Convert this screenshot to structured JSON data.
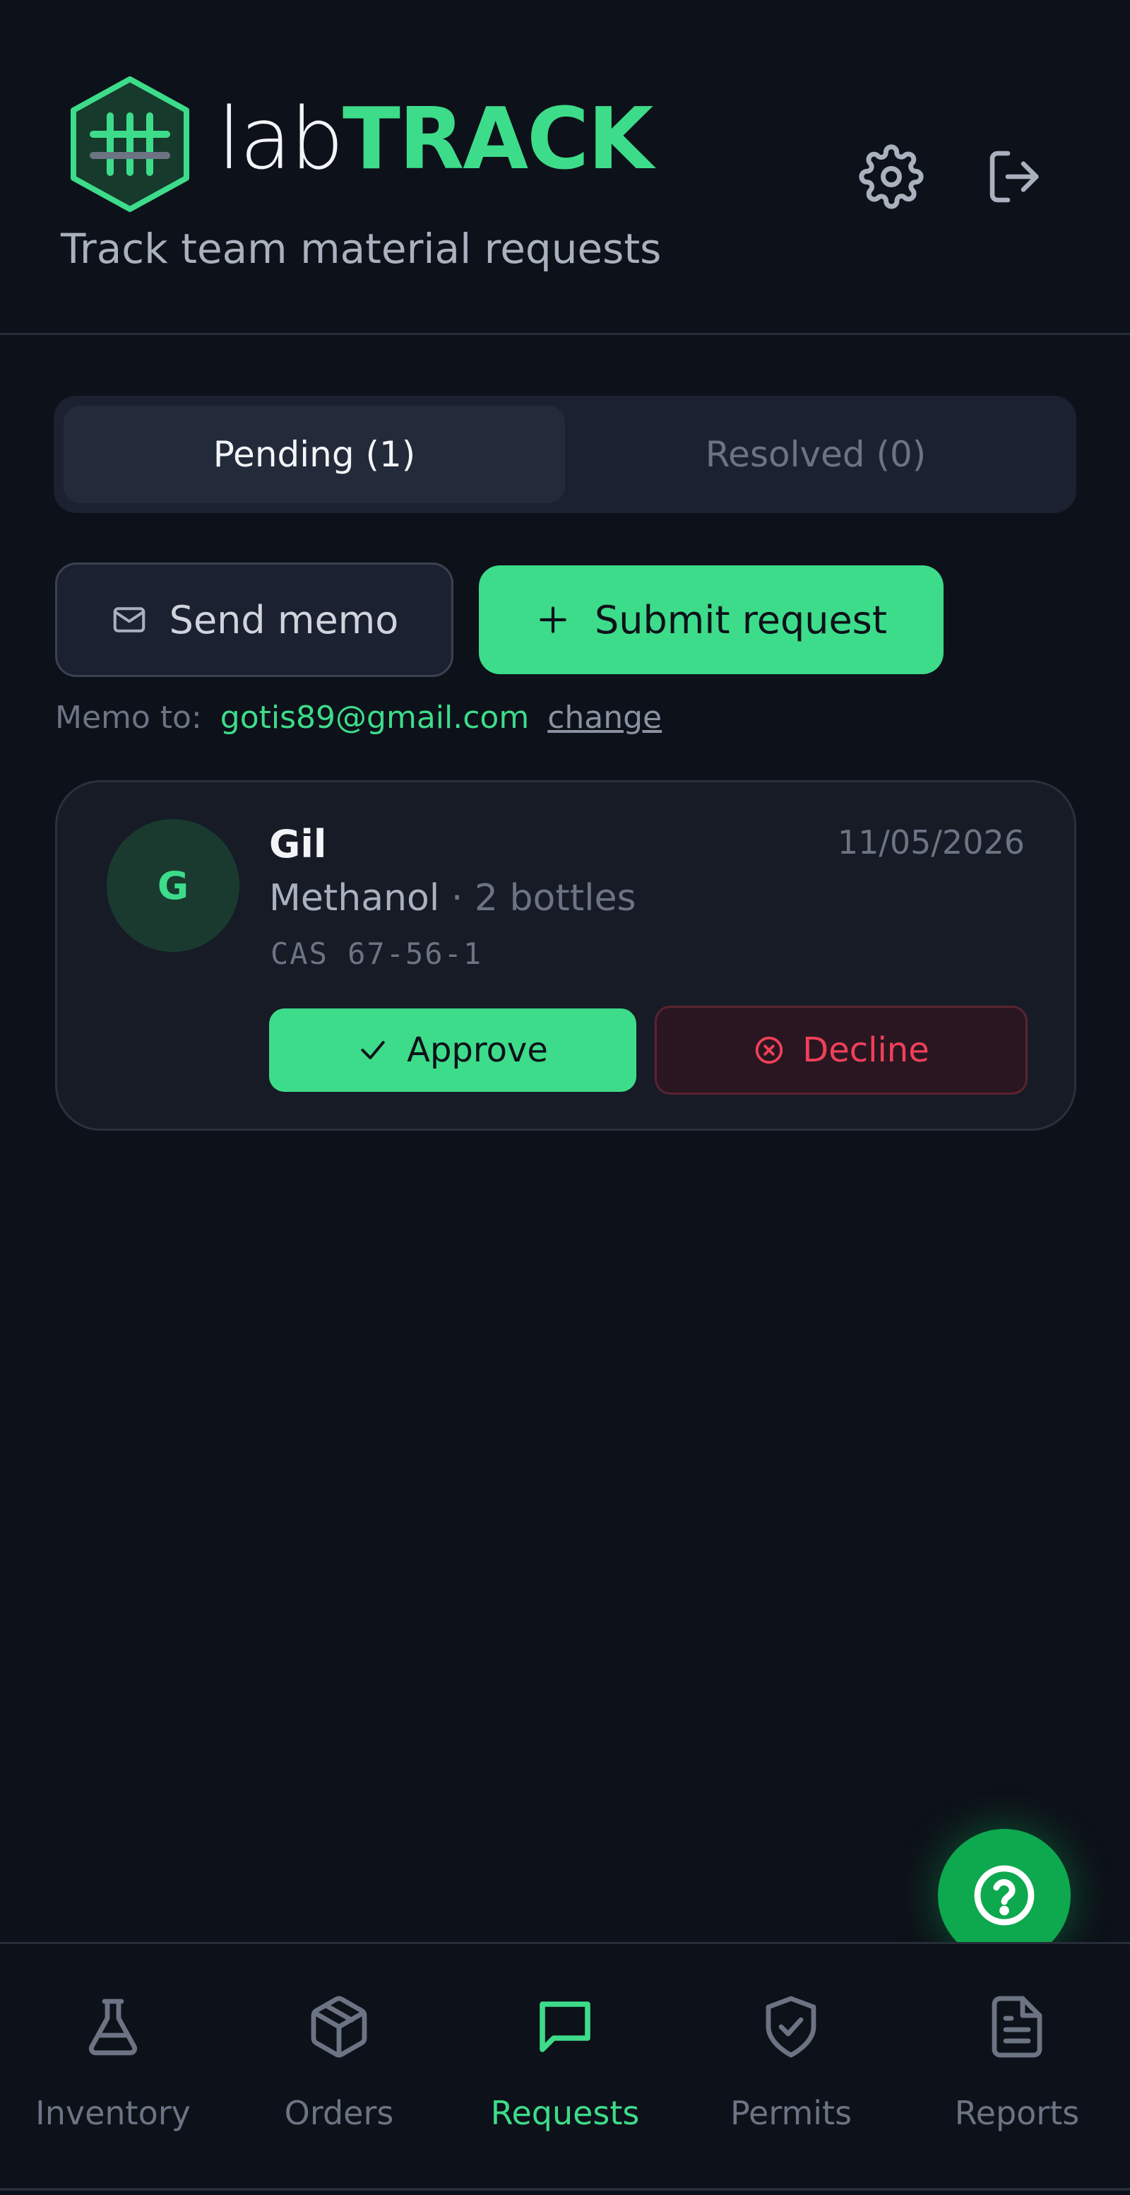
{
  "header": {
    "brand_lab": "lab",
    "brand_track": "TRACK",
    "tagline": "Track team material requests",
    "settings_icon": "gear-icon",
    "logout_icon": "logout-icon"
  },
  "tabs": [
    {
      "label": "Pending (1)",
      "active": true
    },
    {
      "label": "Resolved (0)",
      "active": false
    }
  ],
  "actions": {
    "send_memo_label": "Send memo",
    "submit_request_label": "Submit request"
  },
  "memo": {
    "label": "Memo to:",
    "email": "gotis89@gmail.com",
    "change_label": "change"
  },
  "requests": [
    {
      "avatar_initial": "G",
      "name": "Gil",
      "date": "11/05/2026",
      "material": "Methanol",
      "separator": "·",
      "quantity": "2 bottles",
      "cas": "CAS 67-56-1",
      "approve_label": "Approve",
      "decline_label": "Decline"
    }
  ],
  "nav": [
    {
      "label": "Inventory",
      "icon": "flask-icon",
      "active": false
    },
    {
      "label": "Orders",
      "icon": "box-icon",
      "active": false
    },
    {
      "label": "Requests",
      "icon": "chat-icon",
      "active": true
    },
    {
      "label": "Permits",
      "icon": "shield-check-icon",
      "active": false
    },
    {
      "label": "Reports",
      "icon": "document-icon",
      "active": false
    }
  ],
  "colors": {
    "background": "#0d1119",
    "accent": "#3ddc8a",
    "danger": "#f0405a",
    "fab": "#0ea84f"
  }
}
